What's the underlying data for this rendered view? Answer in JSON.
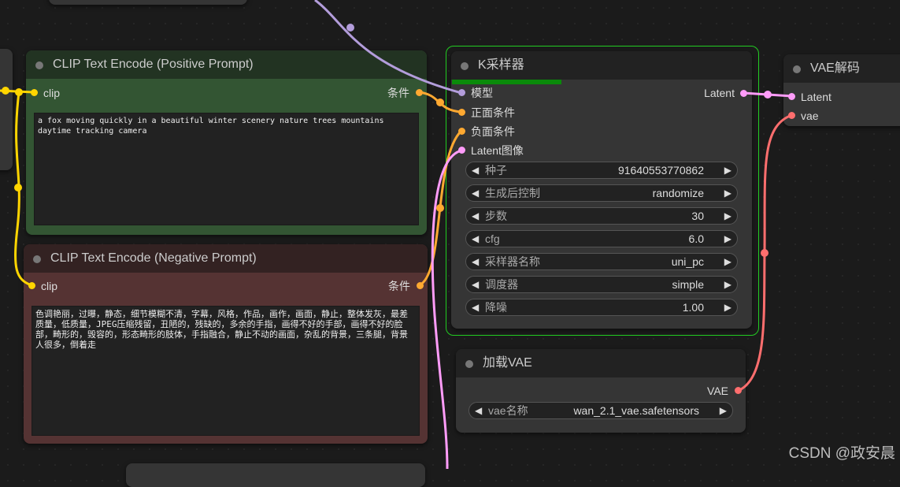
{
  "colors": {
    "model": "#b39ddb",
    "conditioning": "#ffa931",
    "clip": "#ffd500",
    "latent": "#ff9cf9",
    "vae": "#ff6e6e",
    "selected_border": "#22cc22",
    "progress": "#0a8a0a"
  },
  "nodes": {
    "clip_positive": {
      "title": "CLIP Text Encode (Positive Prompt)",
      "input_label": "clip",
      "output_label": "条件",
      "text": "a fox moving quickly in a beautiful winter scenery nature trees mountains daytime tracking camera"
    },
    "clip_negative": {
      "title": "CLIP Text Encode (Negative Prompt)",
      "input_label": "clip",
      "output_label": "条件",
      "text": "色调艳丽，过曝，静态，细节模糊不清，字幕，风格，作品，画作，画面，静止，整体发灰，最差质量，低质量，JPEG压缩残留，丑陋的，残缺的，多余的手指，画得不好的手部，画得不好的脸部，畸形的，毁容的，形态畸形的肢体，手指融合，静止不动的画面，杂乱的背景，三条腿，背景人很多，倒着走"
    },
    "ksampler": {
      "title": "K采样器",
      "progress": 0.3,
      "inputs": [
        "模型",
        "正面条件",
        "负面条件",
        "Latent图像"
      ],
      "output_label": "Latent",
      "widgets": [
        {
          "label": "种子",
          "value": "91640553770862"
        },
        {
          "label": "生成后控制",
          "value": "randomize"
        },
        {
          "label": "步数",
          "value": "30"
        },
        {
          "label": "cfg",
          "value": "6.0"
        },
        {
          "label": "采样器名称",
          "value": "uni_pc"
        },
        {
          "label": "调度器",
          "value": "simple"
        },
        {
          "label": "降噪",
          "value": "1.00"
        }
      ]
    },
    "vae_decode": {
      "title": "VAE解码",
      "inputs": [
        "Latent",
        "vae"
      ]
    },
    "load_vae": {
      "title": "加载VAE",
      "output_label": "VAE",
      "widget": {
        "label": "vae名称",
        "value": "wan_2.1_vae.safetensors"
      }
    }
  },
  "watermark": "CSDN @政安晨",
  "icons": [
    "node-collapse-dot-icon",
    "arrow-left-icon",
    "arrow-right-icon"
  ]
}
